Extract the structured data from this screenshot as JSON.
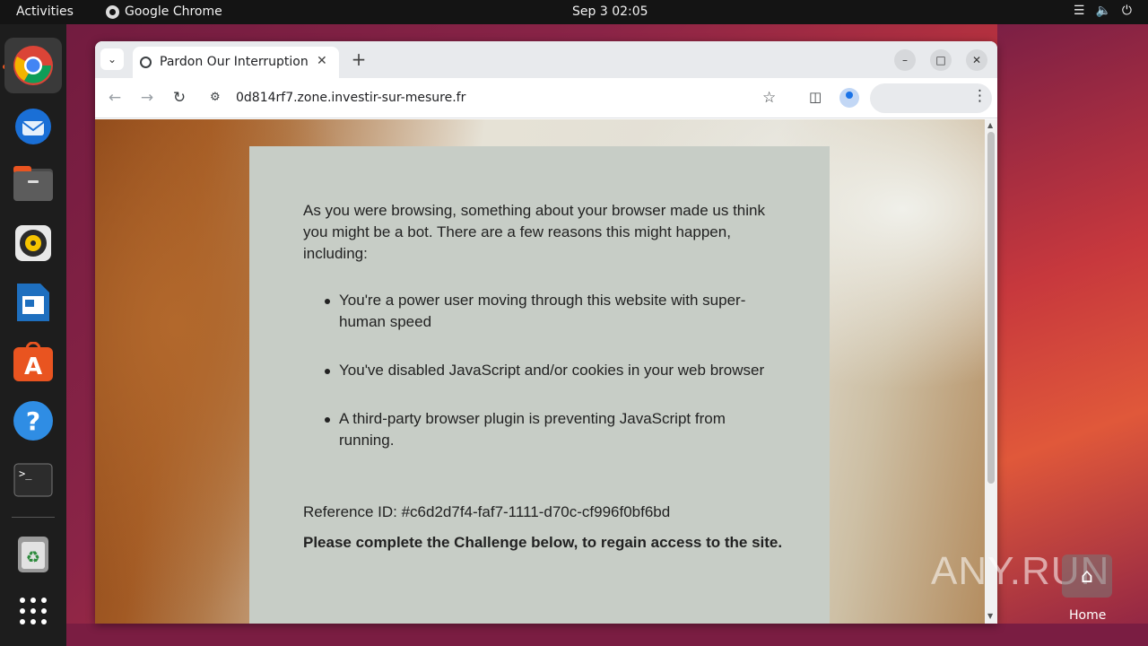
{
  "topbar": {
    "activities": "Activities",
    "app_name": "Google Chrome",
    "clock": "Sep 3  02:05"
  },
  "dock": {
    "items": [
      "chrome-icon",
      "thunderbird-icon",
      "files-icon",
      "rhythmbox-icon",
      "libreoffice-writer-icon",
      "app-center-icon",
      "help-icon",
      "terminal-icon",
      "trash-icon",
      "app-grid-icon"
    ]
  },
  "browser": {
    "tab_title": "Pardon Our Interruption",
    "url": "0d814rf7.zone.investir-sur-mesure.fr"
  },
  "page": {
    "intro": "As you were browsing, something about your browser made us think you might be a bot. There are a few reasons this might happen, including:",
    "reasons": [
      "You're a power user moving through this website with super-human speed",
      "You've disabled JavaScript and/or cookies in your web browser",
      "A third-party browser plugin is preventing JavaScript from running."
    ],
    "reference": "Reference ID: #c6d2d7f4-faf7-1111-d70c-cf996f0bf6bd",
    "challenge": "Please complete the Challenge below, to regain access to the site."
  },
  "desktop": {
    "watermark": "ANY.RUN",
    "home_label": "Home"
  },
  "colors": {
    "card_bg": "#c7cdc6",
    "ubuntu_orange": "#e95420"
  }
}
